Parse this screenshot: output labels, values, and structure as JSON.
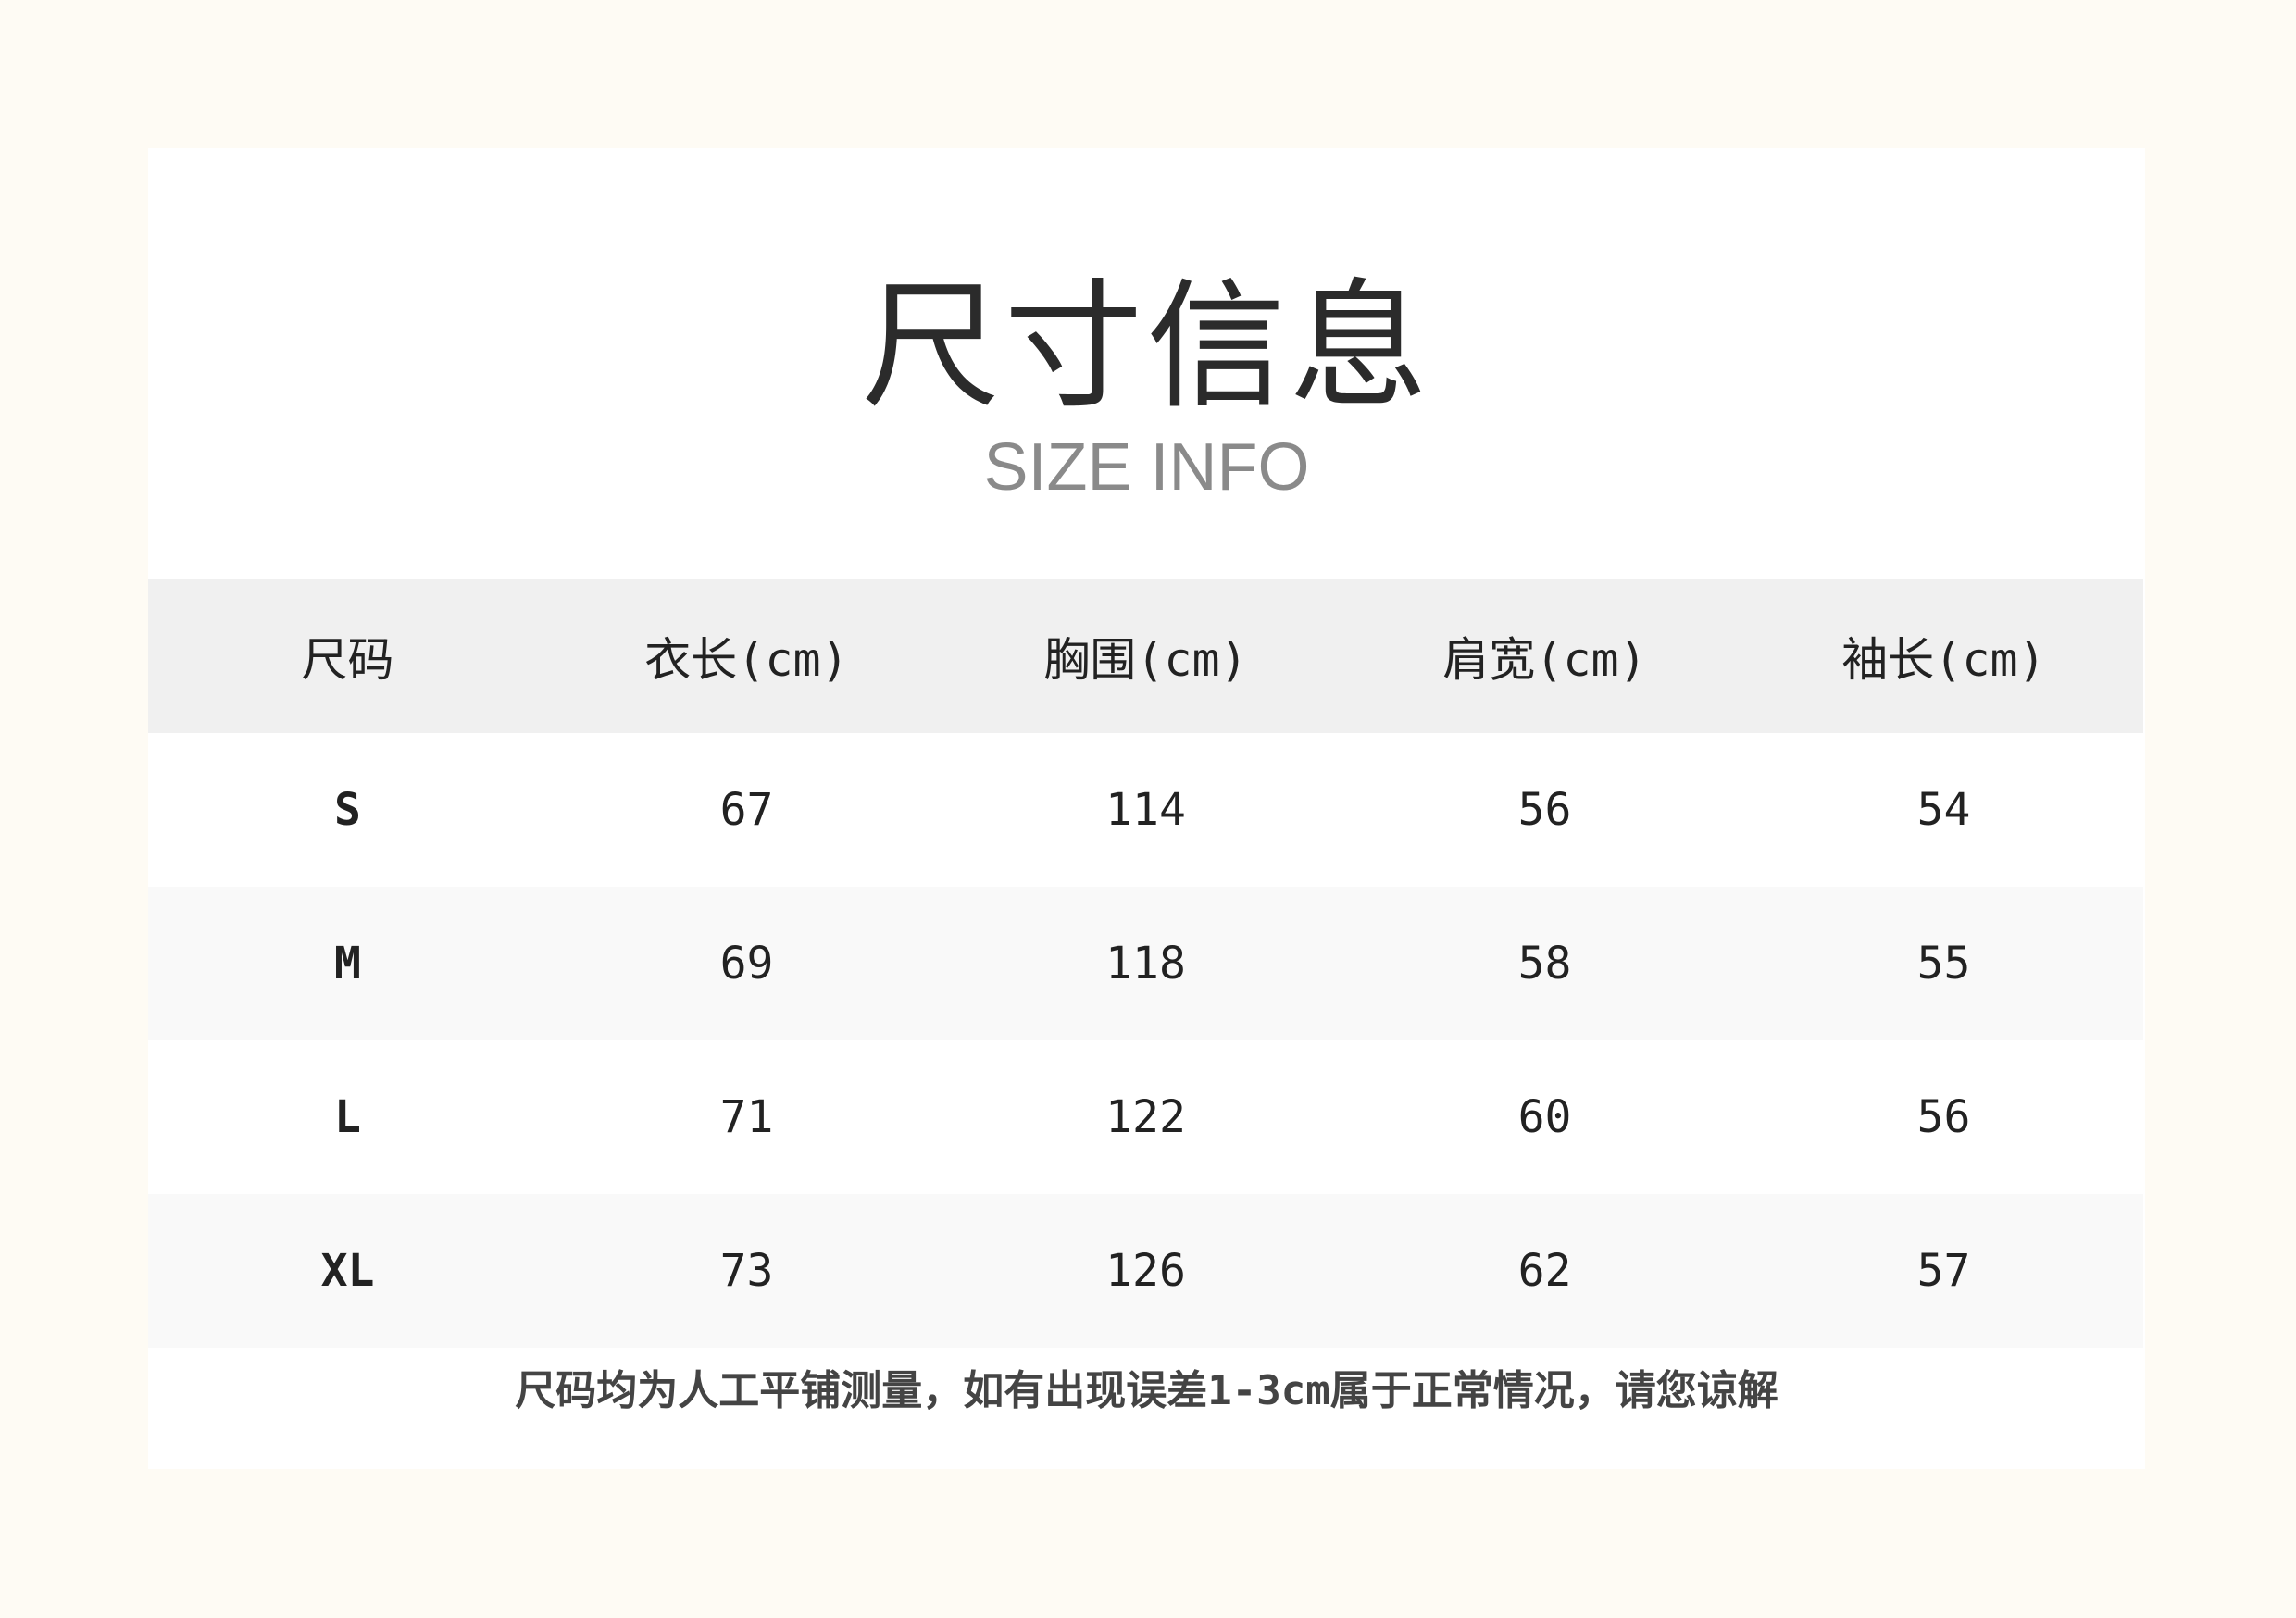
{
  "header": {
    "title": "尺寸信息",
    "subtitle": "SIZE INFO"
  },
  "table": {
    "columns": [
      "尺码",
      "衣长(cm)",
      "胸围(cm)",
      "肩宽(cm)",
      "袖长(cm)"
    ],
    "rows": [
      [
        "S",
        "67",
        "114",
        "56",
        "54"
      ],
      [
        "M",
        "69",
        "118",
        "58",
        "55"
      ],
      [
        "L",
        "71",
        "122",
        "60",
        "56"
      ],
      [
        "XL",
        "73",
        "126",
        "62",
        "57"
      ]
    ]
  },
  "footer": {
    "note": "尺码均为人工平铺测量，如有出现误差1-3cm属于正常情况，请您谅解"
  },
  "colors": {
    "page_background": "#fefbf4",
    "card_background": "#ffffff",
    "header_row_background": "#f0f0f0",
    "alt_row_background": "#f9f9f9",
    "title_color": "#2b2b2b",
    "subtitle_color": "#8a8a8a"
  }
}
